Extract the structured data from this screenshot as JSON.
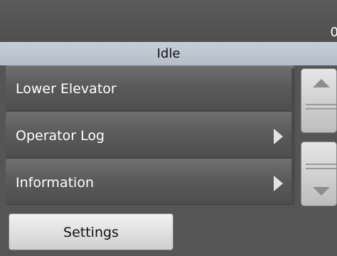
{
  "header": {
    "counter": "0"
  },
  "status": {
    "label": "Idle"
  },
  "menu": {
    "items": [
      {
        "label": "Lower Elevator"
      },
      {
        "label": "Operator Log"
      },
      {
        "label": "Information"
      }
    ]
  },
  "scroll": {
    "up_icon": "arrow-up-icon",
    "down_icon": "arrow-down-icon"
  },
  "footer": {
    "settings_label": "Settings"
  }
}
